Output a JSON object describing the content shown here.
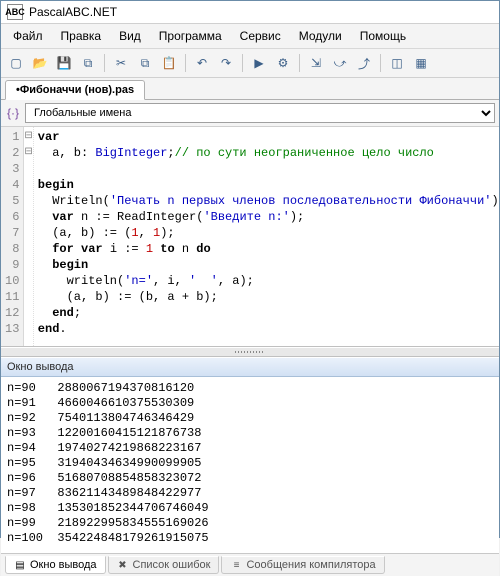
{
  "app": {
    "title": "PascalABC.NET",
    "icon_text": "ABC"
  },
  "menu": [
    "Файл",
    "Правка",
    "Вид",
    "Программа",
    "Сервис",
    "Модули",
    "Помощь"
  ],
  "toolbar_icons": [
    {
      "name": "new-icon",
      "g": "▢"
    },
    {
      "name": "open-icon",
      "g": "📂"
    },
    {
      "name": "save-icon",
      "g": "💾"
    },
    {
      "name": "save-all-icon",
      "g": "⧉"
    },
    {
      "name": "sep",
      "g": ""
    },
    {
      "name": "cut-icon",
      "g": "✂"
    },
    {
      "name": "copy-icon",
      "g": "⧉"
    },
    {
      "name": "paste-icon",
      "g": "📋"
    },
    {
      "name": "sep",
      "g": ""
    },
    {
      "name": "undo-icon",
      "g": "↶"
    },
    {
      "name": "redo-icon",
      "g": "↷"
    },
    {
      "name": "sep",
      "g": ""
    },
    {
      "name": "run-icon",
      "g": "▶"
    },
    {
      "name": "settings-icon",
      "g": "⚙"
    },
    {
      "name": "sep",
      "g": ""
    },
    {
      "name": "step-into-icon",
      "g": "⇲"
    },
    {
      "name": "step-over-icon",
      "g": "⤻"
    },
    {
      "name": "step-out-icon",
      "g": "⤴"
    },
    {
      "name": "sep",
      "g": ""
    },
    {
      "name": "toggle-icon",
      "g": "◫"
    },
    {
      "name": "form-icon",
      "g": "▦"
    }
  ],
  "tab": {
    "label": "•Фибоначчи (нов).pas"
  },
  "scope": {
    "label": "Глобальные имена"
  },
  "code": {
    "lines": [
      {
        "n": 1,
        "fold": "⊟",
        "html": "<span class='k'>var</span>"
      },
      {
        "n": 2,
        "fold": "",
        "html": "  a, b: <span class='t'>BigInteger</span>;<span class='c'>// по сути неограниченное цело число</span>"
      },
      {
        "n": 3,
        "fold": "",
        "html": ""
      },
      {
        "n": 4,
        "fold": "⊟",
        "html": "<span class='k'>begin</span>"
      },
      {
        "n": 5,
        "fold": "",
        "html": "  Writeln(<span class='s'>'Печать n первых членов последовательности Фибоначчи'</span>);"
      },
      {
        "n": 6,
        "fold": "",
        "html": "  <span class='k'>var</span> n := ReadInteger(<span class='s'>'Введите n:'</span>);"
      },
      {
        "n": 7,
        "fold": "",
        "html": "  (a, b) := (<span class='n'>1</span>, <span class='n'>1</span>);"
      },
      {
        "n": 8,
        "fold": "",
        "html": "  <span class='k'>for</span> <span class='k'>var</span> i := <span class='n'>1</span> <span class='k'>to</span> n <span class='k'>do</span>"
      },
      {
        "n": 9,
        "fold": "",
        "html": "  <span class='k'>begin</span>"
      },
      {
        "n": 10,
        "fold": "",
        "html": "    writeln(<span class='s'>'n='</span>, i, <span class='s'>'  '</span>, a);"
      },
      {
        "n": 11,
        "fold": "",
        "html": "    (a, b) := (b, a + b);"
      },
      {
        "n": 12,
        "fold": "",
        "html": "  <span class='k'>end</span>;"
      },
      {
        "n": 13,
        "fold": "",
        "html": "<span class='k'>end</span>."
      }
    ]
  },
  "output": {
    "title": "Окно вывода",
    "lines": [
      "n=90   2880067194370816120",
      "n=91   4660046610375530309",
      "n=92   7540113804746346429",
      "n=93   12200160415121876738",
      "n=94   19740274219868223167",
      "n=95   31940434634990099905",
      "n=96   51680708854858323072",
      "n=97   83621143489848422977",
      "n=98   135301852344706746049",
      "n=99   218922995834555169026",
      "n=100  354224848179261915075"
    ]
  },
  "bottom_tabs": [
    {
      "name": "output-tab",
      "label": "Окно вывода",
      "icon": "▤",
      "active": true
    },
    {
      "name": "errors-tab",
      "label": "Список ошибок",
      "icon": "✖",
      "active": false
    },
    {
      "name": "compiler-tab",
      "label": "Сообщения компилятора",
      "icon": "≡",
      "active": false
    }
  ]
}
